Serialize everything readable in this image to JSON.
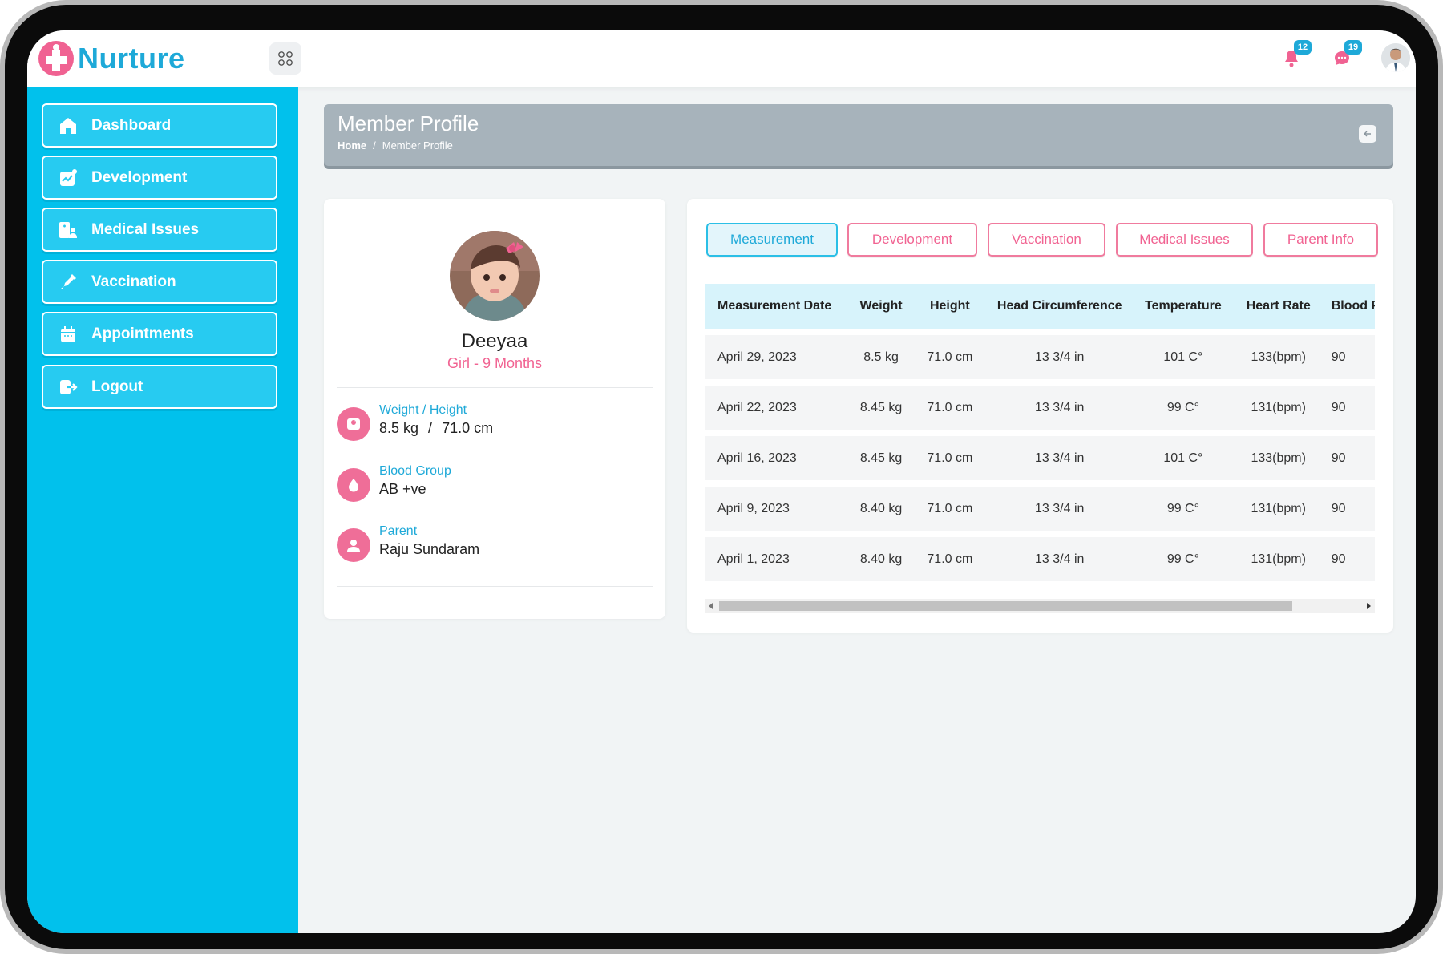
{
  "brand": {
    "name": "Nurture"
  },
  "header": {
    "notifications_count": "12",
    "messages_count": "19"
  },
  "sidebar": {
    "items": [
      {
        "label": "Dashboard",
        "icon": "home-icon"
      },
      {
        "label": "Development",
        "icon": "chart-icon"
      },
      {
        "label": "Medical Issues",
        "icon": "medical-icon"
      },
      {
        "label": "Vaccination",
        "icon": "syringe-icon"
      },
      {
        "label": "Appointments",
        "icon": "calendar-icon"
      },
      {
        "label": "Logout",
        "icon": "logout-icon"
      }
    ]
  },
  "page": {
    "title": "Member Profile",
    "breadcrumb_home": "Home",
    "breadcrumb_sep": "/",
    "breadcrumb_current": "Member Profile"
  },
  "profile": {
    "name": "Deeyaa",
    "subtitle": "Girl - 9 Months",
    "weight_height_label": "Weight / Height",
    "weight": "8.5 kg",
    "height_sep": "/",
    "height": "71.0 cm",
    "blood_group_label": "Blood Group",
    "blood_group": "AB +ve",
    "parent_label": "Parent",
    "parent": "Raju Sundaram"
  },
  "tabs": [
    {
      "label": "Measurement",
      "active": true
    },
    {
      "label": "Development",
      "active": false
    },
    {
      "label": "Vaccination",
      "active": false
    },
    {
      "label": "Medical Issues",
      "active": false
    },
    {
      "label": "Parent Info",
      "active": false
    }
  ],
  "table": {
    "headers": [
      "Measurement Date",
      "Weight",
      "Height",
      "Head Circumference",
      "Temperature",
      "Heart Rate",
      "Blood Pressure"
    ],
    "rows": [
      [
        "April 29, 2023",
        "8.5 kg",
        "71.0 cm",
        "13 3/4 in",
        "101 C°",
        "133(bpm)",
        "90"
      ],
      [
        "April 22, 2023",
        "8.45 kg",
        "71.0 cm",
        "13 3/4 in",
        "99 C°",
        "131(bpm)",
        "90"
      ],
      [
        "April 16, 2023",
        "8.45 kg",
        "71.0 cm",
        "13 3/4 in",
        "101 C°",
        "133(bpm)",
        "90"
      ],
      [
        "April 9, 2023",
        "8.40 kg",
        "71.0 cm",
        "13 3/4 in",
        "99 C°",
        "131(bpm)",
        "90"
      ],
      [
        "April 1, 2023",
        "8.40 kg",
        "71.0 cm",
        "13 3/4 in",
        "99 C°",
        "131(bpm)",
        "90"
      ]
    ]
  },
  "colors": {
    "sidebar": "#01c1ec",
    "brand": "#1ea9d8",
    "accent_pink": "#f16392",
    "title_bar": "#a7b3bb"
  }
}
